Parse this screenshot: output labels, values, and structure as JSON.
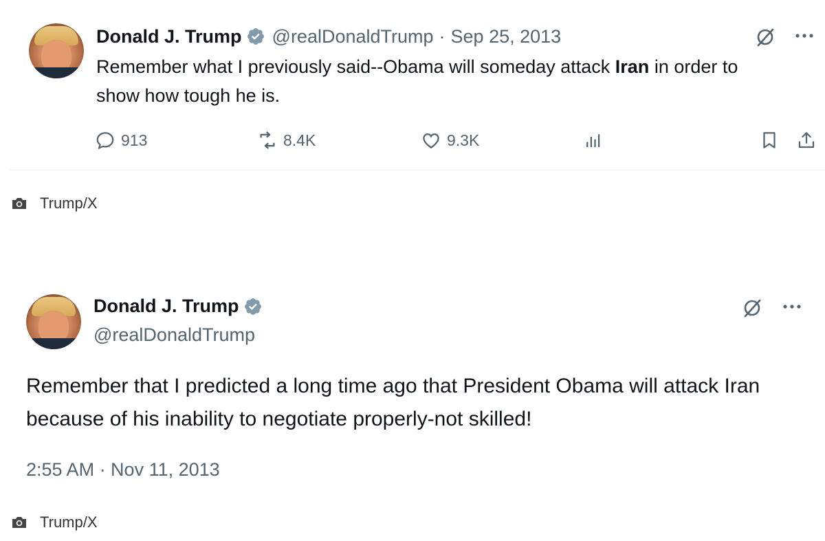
{
  "tweet1": {
    "name": "Donald J. Trump",
    "handle": "@realDonaldTrump",
    "date": "Sep 25, 2013",
    "text_before": "Remember what I previously said--Obama will someday attack ",
    "text_bold": "Iran",
    "text_after": " in order to show how tough he is.",
    "replies": "913",
    "reposts": "8.4K",
    "likes": "9.3K"
  },
  "caption1": "Trump/X",
  "tweet2": {
    "name": "Donald J. Trump",
    "handle": "@realDonaldTrump",
    "text": "Remember that I predicted a long time ago that President Obama will attack Iran because of his inability to negotiate properly-not skilled!",
    "timestamp": "2:55 AM · Nov 11, 2013"
  },
  "caption2": "Trump/X",
  "colors": {
    "verified": "#1d9bf0",
    "muted": "#536471",
    "text": "#0f1419"
  },
  "icons": [
    "verified-badge-icon",
    "grok-icon",
    "more-icon",
    "reply-icon",
    "repost-icon",
    "like-icon",
    "views-icon",
    "bookmark-icon",
    "share-icon",
    "camera-icon"
  ]
}
